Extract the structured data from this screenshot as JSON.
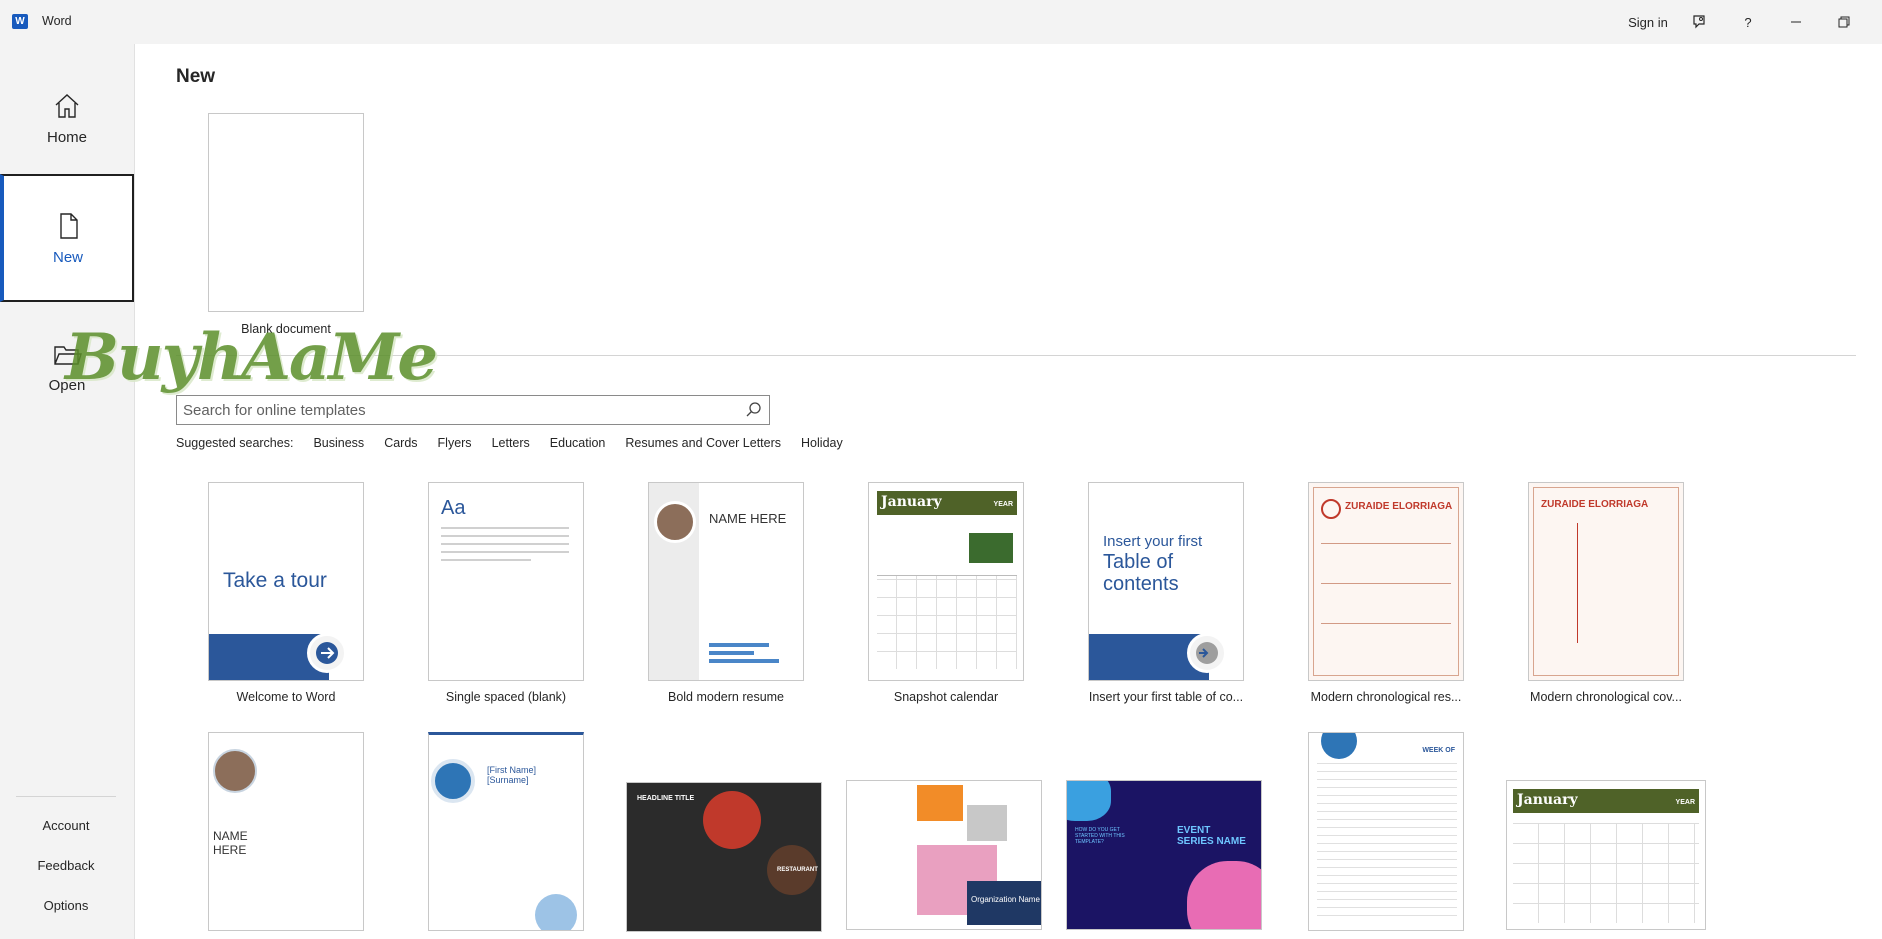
{
  "titlebar": {
    "app_name": "Word",
    "app_icon": "W",
    "sign_in": "Sign in",
    "help": "?",
    "feedback_icon": "feedback-icon",
    "minimize_icon": "minimize-icon",
    "restore_icon": "restore-icon"
  },
  "sidebar": {
    "items": [
      {
        "label": "Home",
        "icon": "home-icon"
      },
      {
        "label": "New",
        "icon": "new-document-icon",
        "active": true
      },
      {
        "label": "Open",
        "icon": "folder-open-icon"
      }
    ],
    "bottom": [
      "Account",
      "Feedback",
      "Options"
    ]
  },
  "main": {
    "title": "New",
    "blank": {
      "label": "Blank document"
    },
    "search": {
      "placeholder": "Search for online templates"
    },
    "suggested_label": "Suggested searches:",
    "suggested": [
      "Business",
      "Cards",
      "Flyers",
      "Letters",
      "Education",
      "Resumes and Cover Letters",
      "Holiday"
    ],
    "templates": [
      {
        "label": "Welcome to Word",
        "text": "Take a tour"
      },
      {
        "label": "Single spaced (blank)",
        "text": "Aa"
      },
      {
        "label": "Bold modern resume",
        "text": "NAME HERE"
      },
      {
        "label": "Snapshot calendar",
        "text": "January",
        "year": "YEAR"
      },
      {
        "label": "Insert your first table of co...",
        "text": "Insert your first",
        "text2": "Table of contents"
      },
      {
        "label": "Modern chronological res...",
        "text": "ZURAIDE ELORRIAGA"
      },
      {
        "label": "Modern chronological cov...",
        "text": "ZURAIDE ELORRIAGA"
      }
    ],
    "row2": [
      {
        "text": "NAME HERE"
      },
      {
        "text": "[First Name] [Surname]"
      },
      {
        "text": "HEADLINE TITLE",
        "text2": "RESTAURANT"
      },
      {
        "text": "Organization Name"
      },
      {
        "text": "EVENT SERIES NAME",
        "text2": "HOW DO YOU GET STARTED WITH THIS TEMPLATE?"
      },
      {
        "text": "WEEK OF"
      },
      {
        "text": "January",
        "year": "YEAR"
      }
    ]
  },
  "watermark": "BuyhAaMe",
  "colors": {
    "accent": "#185abd",
    "word_blue": "#2b579a",
    "green": "#4f6228",
    "red": "#c0392b"
  }
}
